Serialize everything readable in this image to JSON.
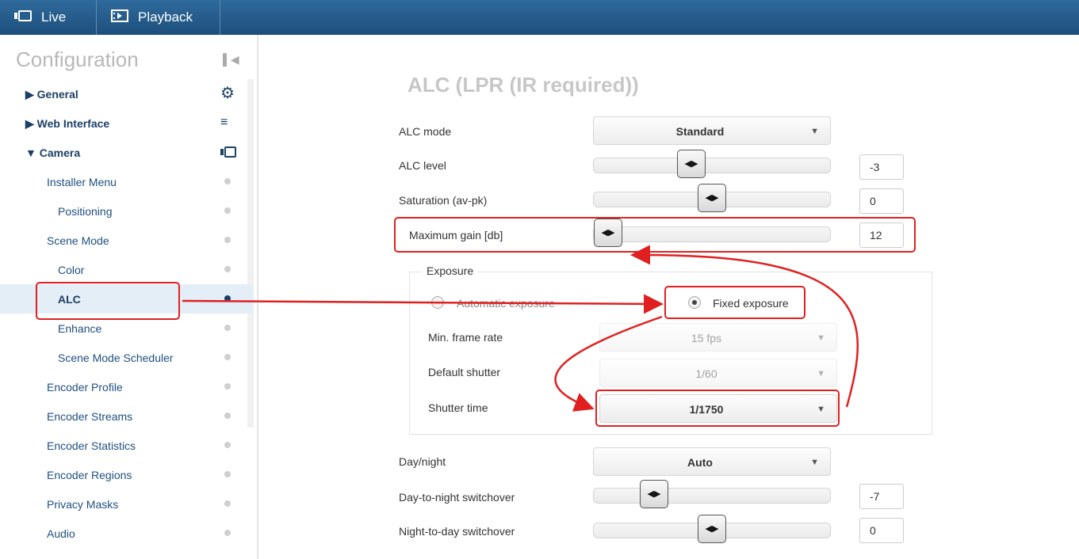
{
  "topbar": {
    "live_label": "Live",
    "playback_label": "Playback"
  },
  "sidebar": {
    "title": "Configuration",
    "items": [
      {
        "label": "General"
      },
      {
        "label": "Web Interface"
      },
      {
        "label": "Camera"
      },
      {
        "label": "Installer Menu"
      },
      {
        "label": "Positioning"
      },
      {
        "label": "Scene Mode"
      },
      {
        "label": "Color"
      },
      {
        "label": "ALC"
      },
      {
        "label": "Enhance"
      },
      {
        "label": "Scene Mode Scheduler"
      },
      {
        "label": "Encoder Profile"
      },
      {
        "label": "Encoder Streams"
      },
      {
        "label": "Encoder Statistics"
      },
      {
        "label": "Encoder Regions"
      },
      {
        "label": "Privacy Masks"
      },
      {
        "label": "Audio"
      }
    ]
  },
  "main": {
    "title": "ALC (LPR (IR required))",
    "alc_mode": {
      "label": "ALC mode",
      "value": "Standard"
    },
    "alc_level": {
      "label": "ALC level",
      "value": "-3",
      "position": 0.4
    },
    "saturation": {
      "label": "Saturation (av-pk)",
      "value": "0",
      "position": 0.5
    },
    "max_gain": {
      "label": "Maximum gain [db]",
      "value": "12",
      "position": 0.0
    },
    "exposure": {
      "legend": "Exposure",
      "automatic_label": "Automatic exposure",
      "fixed_label": "Fixed exposure",
      "min_frame_rate": {
        "label": "Min. frame rate",
        "value": "15 fps"
      },
      "default_shutter": {
        "label": "Default shutter",
        "value": "1/60"
      },
      "shutter_time": {
        "label": "Shutter time",
        "value": "1/1750"
      }
    },
    "day_night": {
      "label": "Day/night",
      "value": "Auto"
    },
    "day_to_night": {
      "label": "Day-to-night switchover",
      "value": "-7",
      "position": 0.22
    },
    "night_to_day": {
      "label": "Night-to-day switchover",
      "value": "0",
      "position": 0.5
    }
  },
  "colors": {
    "topbar": "#1d4f7c",
    "nav_text": "#1f4f80",
    "annotation": "#e02020",
    "selected_bg": "#e3eef7"
  },
  "icons": {
    "live": "camera-icon",
    "playback": "playback-icon",
    "general": "gear-icon",
    "web_interface": "menu-icon",
    "camera": "camera-icon",
    "collapse": "collapse-left-icon",
    "slider_handle": "left-right-arrows-icon"
  }
}
